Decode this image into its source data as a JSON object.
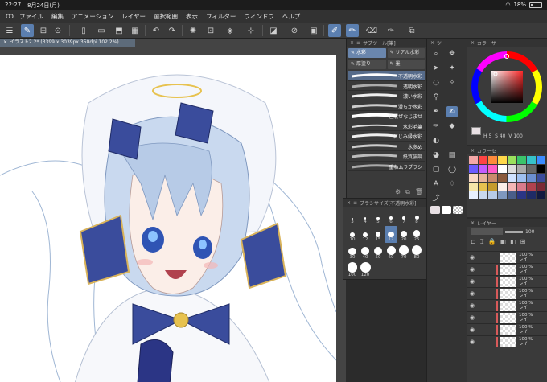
{
  "status": {
    "time": "22:27",
    "date": "8月24日(月)",
    "battery": "18%"
  },
  "menu": [
    "ファイル",
    "編集",
    "アニメーション",
    "レイヤー",
    "選択範囲",
    "表示",
    "フィルター",
    "ウィンドウ",
    "ヘルプ"
  ],
  "document": {
    "tab_title": "イラスト2 2* (3399 x 3039px 350dpi 102.2%)"
  },
  "subtool": {
    "title": "サブツール[筆]",
    "tabs": [
      "水彩",
      "リアル水彩",
      "厚塗り",
      "墨"
    ],
    "brushes": [
      "不透明水彩",
      "透明水彩",
      "濃い水彩",
      "滑らか水彩",
      "色混ぜなじませ",
      "水彩毛筆",
      "にじみ縁水彩",
      "水多め",
      "紙質強調",
      "重ねムラブラシ"
    ],
    "selected_brush": "不透明水彩"
  },
  "brush_size": {
    "title": "ブラシサイズ[不透明水彩]",
    "sizes": [
      "3",
      "4",
      "5",
      "6",
      "7",
      "8",
      "10",
      "12",
      "15",
      "17",
      "20",
      "25",
      "30",
      "40",
      "50",
      "60",
      "70",
      "80",
      "100",
      "120"
    ],
    "selected": "17"
  },
  "tool_panel": {
    "title": "ツー"
  },
  "color_wheel": {
    "title": "カラーサー",
    "h": "H",
    "h_value": "5",
    "s": "S",
    "s_value": "40",
    "v": "V",
    "v_value": "100",
    "main_color": "#e8e0e4"
  },
  "color_set": {
    "title": "カラーセ"
  },
  "layer_panel": {
    "title": "レイヤー",
    "opacity": "100",
    "layers": [
      {
        "opacity": "100 %",
        "name": "レイ"
      },
      {
        "opacity": "100 %",
        "name": "レイ"
      },
      {
        "opacity": "100 %",
        "name": "レイ"
      },
      {
        "opacity": "100 %",
        "name": "レイ"
      },
      {
        "opacity": "100 %",
        "name": "レイ"
      },
      {
        "opacity": "100 %",
        "name": "レイ"
      },
      {
        "opacity": "100 %",
        "name": "レイ"
      },
      {
        "opacity": "100 %",
        "name": "レイ"
      }
    ]
  },
  "icons": [
    "hamburger-icon",
    "brush-icon",
    "undo-icon",
    "redo-icon",
    "eye-icon",
    "close-icon",
    "chevron-down-icon"
  ]
}
